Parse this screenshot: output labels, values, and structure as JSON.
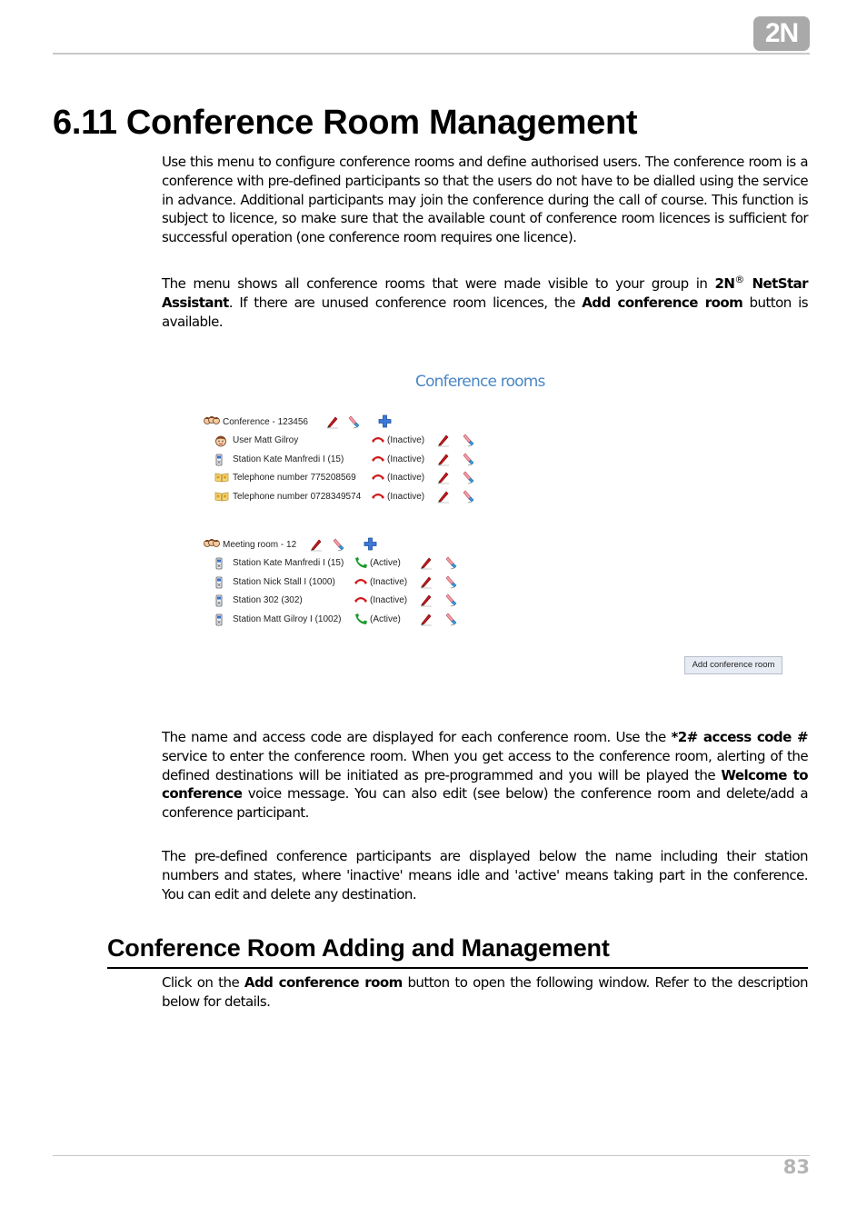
{
  "header": {
    "logo_text": "2N"
  },
  "title": "6.11 Conference Room Management",
  "intro": {
    "p1": "Use this menu to configure conference rooms and define authorised users. The conference room is a conference with pre-defined participants so that the users do not have to be dialled using the service in advance. Additional participants may join the conference during the call of course. This function is subject to licence, so make sure that the available count of conference room licences is sufficient for successful operation (one conference room requires one licence).",
    "p2_a": "The menu shows all conference rooms that were made visible to your group in ",
    "p2_brand": "2N",
    "p2_reg": "®",
    "p2_product": " NetStar Assistant",
    "p2_b": ". If there are unused conference room licences, the ",
    "p2_bold2": "Add conference room",
    "p2_c": " button is available."
  },
  "ui": {
    "title": "Conference rooms",
    "rooms": [
      {
        "name": "Conference - 123456",
        "participants": [
          {
            "type": "user",
            "label": "User  Matt Gilroy",
            "state": "(Inactive)",
            "active": false
          },
          {
            "type": "station",
            "label": "Station  Kate Manfredi I (15)",
            "state": "(Inactive)",
            "active": false
          },
          {
            "type": "phonebook",
            "label": "Telephone number  775208569",
            "state": "(Inactive)",
            "active": false
          },
          {
            "type": "phonebook",
            "label": "Telephone number  0728349574",
            "state": "(Inactive)",
            "active": false
          }
        ]
      },
      {
        "name": "Meeting room - 12",
        "participants": [
          {
            "type": "station",
            "label": "Station  Kate Manfredi I (15)",
            "state": "(Active)",
            "active": true
          },
          {
            "type": "station",
            "label": "Station  Nick Stall I (1000)",
            "state": "(Inactive)",
            "active": false
          },
          {
            "type": "station",
            "label": "Station  302 (302)",
            "state": "(Inactive)",
            "active": false
          },
          {
            "type": "station",
            "label": "Station  Matt Gilroy I (1002)",
            "state": "(Active)",
            "active": true
          }
        ]
      }
    ],
    "add_button": "Add conference room",
    "colors": {
      "title": "#4a86c5",
      "active_phone": "#1a9a2a",
      "inactive_phone": "#d01818",
      "add_icon": "#3b78d8"
    }
  },
  "body": {
    "p3_a": "The name and access code are displayed for each conference room. Use the ",
    "p3_bold1": "*2# access code #",
    "p3_b": " service to enter the conference room. When you get access to the conference room, alerting of the defined destinations will be initiated as pre-programmed and you will be played the ",
    "p3_bold2": "Welcome to conference",
    "p3_c": " voice message. You can also edit (see below) the conference room and delete/add a conference participant.",
    "p4": "The pre-defined conference participants are displayed below the name including their station numbers and states, where 'inactive' means idle and 'active' means taking part in the conference. You can edit and delete any destination."
  },
  "section2": {
    "heading": "Conference Room Adding and Management",
    "p_a": "Click on the ",
    "p_bold": "Add conference room",
    "p_b": " button to open the following window. Refer to the description below for details."
  },
  "footer": {
    "page_number": "83"
  }
}
